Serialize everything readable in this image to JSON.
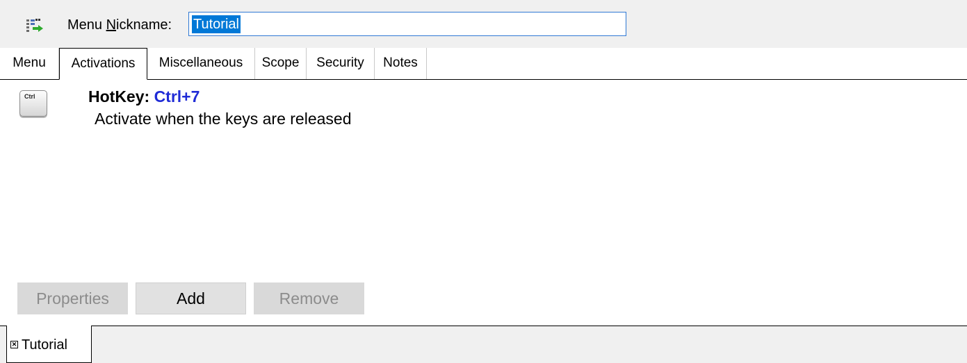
{
  "header": {
    "icon": "menu-edit-icon",
    "nickname_label_pre": "Menu ",
    "nickname_label_accel": "N",
    "nickname_label_post": "ickname:",
    "nickname_value": "Tutorial"
  },
  "tabs": [
    {
      "label": "Menu",
      "active": false
    },
    {
      "label": "Activations",
      "active": true
    },
    {
      "label": "Miscellaneous",
      "active": false
    },
    {
      "label": "Scope",
      "active": false
    },
    {
      "label": "Security",
      "active": false
    },
    {
      "label": "Notes",
      "active": false
    }
  ],
  "activation": {
    "key_icon_text": "Ctrl",
    "title_prefix": "HotKey: ",
    "title_value": "Ctrl+7",
    "description": "Activate when the keys are released",
    "value_color": "#1f2bd6"
  },
  "buttons": {
    "properties": "Properties",
    "add": "Add",
    "remove": "Remove"
  },
  "bottom_tab": {
    "close_glyph": "✕",
    "label": "Tutorial"
  }
}
